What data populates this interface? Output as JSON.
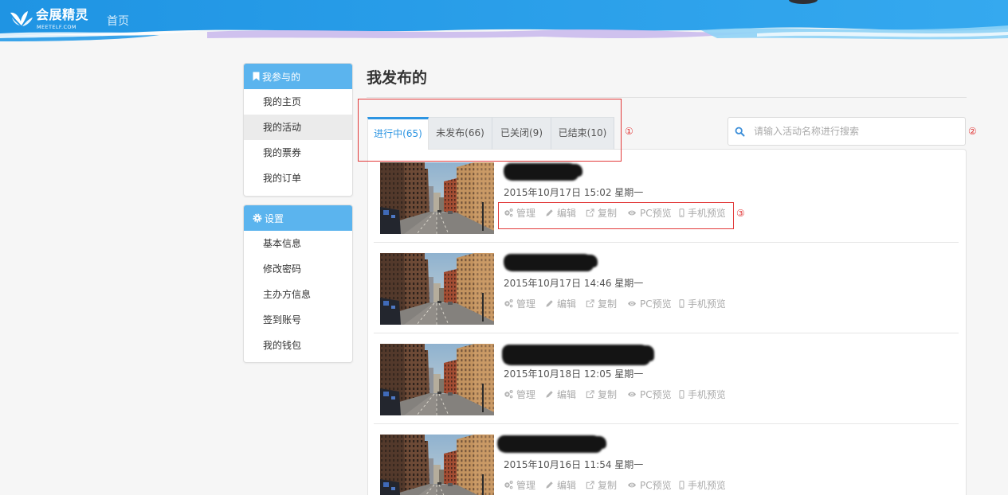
{
  "header": {
    "logo_text": "会展精灵",
    "logo_subtext": "MEETELF.COM",
    "logo_icon": "meetelf-logo-icon",
    "nav_home": "首页"
  },
  "sidebar": {
    "groups": [
      {
        "title": "我参与的",
        "icon": "bookmark-icon",
        "items": [
          {
            "label": "我的主页"
          },
          {
            "label": "我的活动",
            "active": true
          },
          {
            "label": "我的票券"
          },
          {
            "label": "我的订单"
          }
        ]
      },
      {
        "title": "设置",
        "icon": "gear-icon",
        "items": [
          {
            "label": "基本信息"
          },
          {
            "label": "修改密码"
          },
          {
            "label": "主办方信息"
          },
          {
            "label": "签到账号"
          },
          {
            "label": "我的钱包"
          }
        ]
      }
    ]
  },
  "main": {
    "title": "我发布的",
    "tabs": [
      {
        "label": "进行中(65)",
        "active": true
      },
      {
        "label": "未发布(66)"
      },
      {
        "label": "已关闭(9)"
      },
      {
        "label": "已结束(10)"
      }
    ],
    "search": {
      "placeholder": "请输入活动名称进行搜索",
      "icon": "search-icon"
    },
    "actions": [
      {
        "label": "管理",
        "icon": "gears-icon"
      },
      {
        "label": "编辑",
        "icon": "pencil-icon"
      },
      {
        "label": "复制",
        "icon": "external-link-icon"
      },
      {
        "label": "PC预览",
        "icon": "eye-icon"
      },
      {
        "label": "手机预览",
        "icon": "mobile-icon"
      }
    ],
    "activities": [
      {
        "date": "2015年10月17日 15:02 星期一"
      },
      {
        "date": "2015年10月17日 14:46 星期一"
      },
      {
        "date": "2015年10月18日 12:05 星期一"
      },
      {
        "date": "2015年10月16日 11:54 星期一"
      }
    ]
  },
  "annotations": {
    "markers": [
      "①",
      "②",
      "③"
    ]
  },
  "colors": {
    "header_blue": "#1f94e3",
    "accent": "#2d95e2",
    "sidebar_header": "#5bb4ee",
    "annotation": "#e23a3a",
    "search_icon": "#3d8fd9"
  }
}
